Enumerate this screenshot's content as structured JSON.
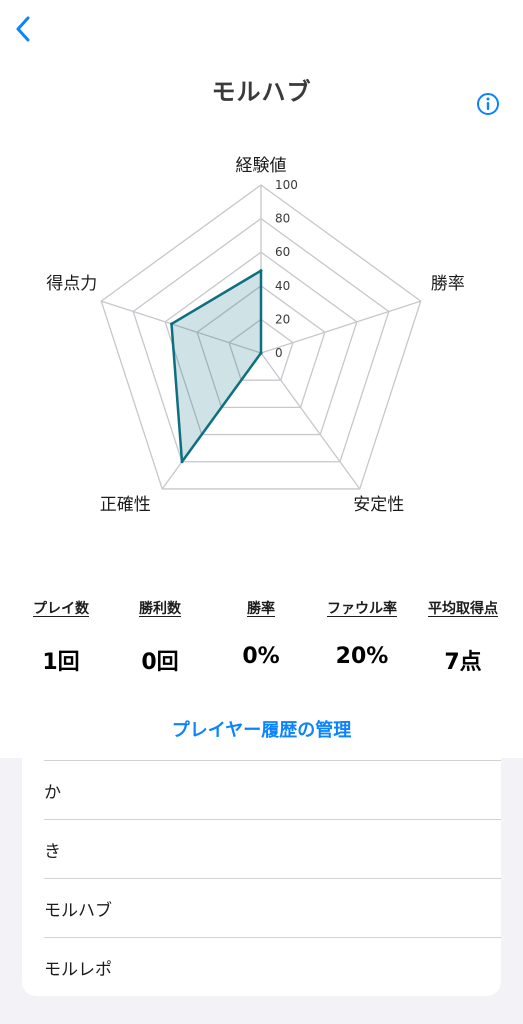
{
  "header": {
    "title": "モルハブ",
    "back_icon": "chevron-left-icon",
    "info_icon": "info-circle-icon",
    "accent_color": "#0a84ff"
  },
  "chart_data": {
    "type": "radar",
    "axes": [
      "経験値",
      "勝率",
      "安定性",
      "正確性",
      "得点力"
    ],
    "ticks": [
      "0",
      "20",
      "40",
      "60",
      "80",
      "100"
    ],
    "range": [
      0,
      100
    ],
    "values": [
      49,
      0,
      0,
      80,
      56
    ],
    "fill_color": "#0e6f80",
    "grid": true
  },
  "stats": [
    {
      "label": "プレイ数",
      "value": "1回"
    },
    {
      "label": "勝利数",
      "value": "0回"
    },
    {
      "label": "勝率",
      "value": "0%"
    },
    {
      "label": "ファウル率",
      "value": "20%"
    },
    {
      "label": "平均取得点",
      "value": "7点"
    }
  ],
  "manage_link": "プレイヤー履歴の管理",
  "players": [
    "か",
    "き",
    "モルハブ",
    "モルレポ"
  ]
}
